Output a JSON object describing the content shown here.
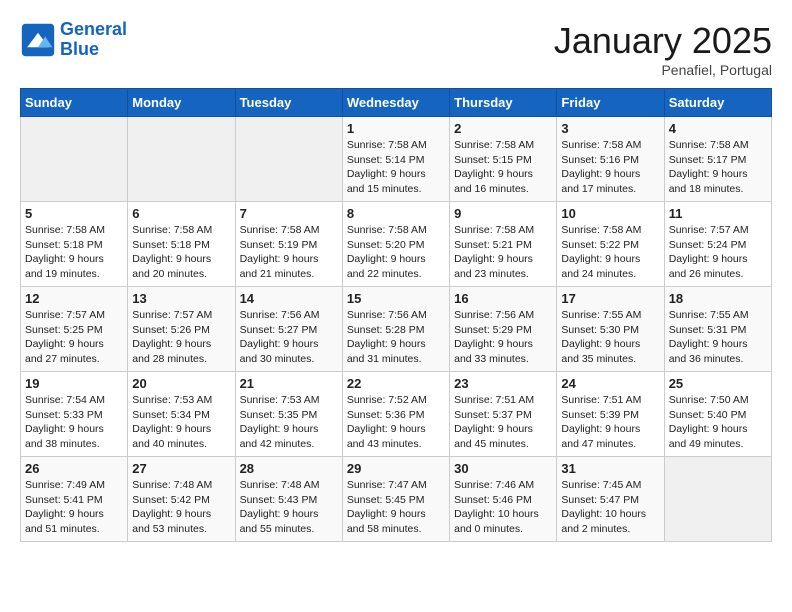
{
  "header": {
    "logo_line1": "General",
    "logo_line2": "Blue",
    "title": "January 2025",
    "subtitle": "Penafiel, Portugal"
  },
  "weekdays": [
    "Sunday",
    "Monday",
    "Tuesday",
    "Wednesday",
    "Thursday",
    "Friday",
    "Saturday"
  ],
  "weeks": [
    [
      {
        "day": "",
        "sunrise": "",
        "sunset": "",
        "daylight": ""
      },
      {
        "day": "",
        "sunrise": "",
        "sunset": "",
        "daylight": ""
      },
      {
        "day": "",
        "sunrise": "",
        "sunset": "",
        "daylight": ""
      },
      {
        "day": "1",
        "sunrise": "Sunrise: 7:58 AM",
        "sunset": "Sunset: 5:14 PM",
        "daylight": "Daylight: 9 hours and 15 minutes."
      },
      {
        "day": "2",
        "sunrise": "Sunrise: 7:58 AM",
        "sunset": "Sunset: 5:15 PM",
        "daylight": "Daylight: 9 hours and 16 minutes."
      },
      {
        "day": "3",
        "sunrise": "Sunrise: 7:58 AM",
        "sunset": "Sunset: 5:16 PM",
        "daylight": "Daylight: 9 hours and 17 minutes."
      },
      {
        "day": "4",
        "sunrise": "Sunrise: 7:58 AM",
        "sunset": "Sunset: 5:17 PM",
        "daylight": "Daylight: 9 hours and 18 minutes."
      }
    ],
    [
      {
        "day": "5",
        "sunrise": "Sunrise: 7:58 AM",
        "sunset": "Sunset: 5:18 PM",
        "daylight": "Daylight: 9 hours and 19 minutes."
      },
      {
        "day": "6",
        "sunrise": "Sunrise: 7:58 AM",
        "sunset": "Sunset: 5:18 PM",
        "daylight": "Daylight: 9 hours and 20 minutes."
      },
      {
        "day": "7",
        "sunrise": "Sunrise: 7:58 AM",
        "sunset": "Sunset: 5:19 PM",
        "daylight": "Daylight: 9 hours and 21 minutes."
      },
      {
        "day": "8",
        "sunrise": "Sunrise: 7:58 AM",
        "sunset": "Sunset: 5:20 PM",
        "daylight": "Daylight: 9 hours and 22 minutes."
      },
      {
        "day": "9",
        "sunrise": "Sunrise: 7:58 AM",
        "sunset": "Sunset: 5:21 PM",
        "daylight": "Daylight: 9 hours and 23 minutes."
      },
      {
        "day": "10",
        "sunrise": "Sunrise: 7:58 AM",
        "sunset": "Sunset: 5:22 PM",
        "daylight": "Daylight: 9 hours and 24 minutes."
      },
      {
        "day": "11",
        "sunrise": "Sunrise: 7:57 AM",
        "sunset": "Sunset: 5:24 PM",
        "daylight": "Daylight: 9 hours and 26 minutes."
      }
    ],
    [
      {
        "day": "12",
        "sunrise": "Sunrise: 7:57 AM",
        "sunset": "Sunset: 5:25 PM",
        "daylight": "Daylight: 9 hours and 27 minutes."
      },
      {
        "day": "13",
        "sunrise": "Sunrise: 7:57 AM",
        "sunset": "Sunset: 5:26 PM",
        "daylight": "Daylight: 9 hours and 28 minutes."
      },
      {
        "day": "14",
        "sunrise": "Sunrise: 7:56 AM",
        "sunset": "Sunset: 5:27 PM",
        "daylight": "Daylight: 9 hours and 30 minutes."
      },
      {
        "day": "15",
        "sunrise": "Sunrise: 7:56 AM",
        "sunset": "Sunset: 5:28 PM",
        "daylight": "Daylight: 9 hours and 31 minutes."
      },
      {
        "day": "16",
        "sunrise": "Sunrise: 7:56 AM",
        "sunset": "Sunset: 5:29 PM",
        "daylight": "Daylight: 9 hours and 33 minutes."
      },
      {
        "day": "17",
        "sunrise": "Sunrise: 7:55 AM",
        "sunset": "Sunset: 5:30 PM",
        "daylight": "Daylight: 9 hours and 35 minutes."
      },
      {
        "day": "18",
        "sunrise": "Sunrise: 7:55 AM",
        "sunset": "Sunset: 5:31 PM",
        "daylight": "Daylight: 9 hours and 36 minutes."
      }
    ],
    [
      {
        "day": "19",
        "sunrise": "Sunrise: 7:54 AM",
        "sunset": "Sunset: 5:33 PM",
        "daylight": "Daylight: 9 hours and 38 minutes."
      },
      {
        "day": "20",
        "sunrise": "Sunrise: 7:53 AM",
        "sunset": "Sunset: 5:34 PM",
        "daylight": "Daylight: 9 hours and 40 minutes."
      },
      {
        "day": "21",
        "sunrise": "Sunrise: 7:53 AM",
        "sunset": "Sunset: 5:35 PM",
        "daylight": "Daylight: 9 hours and 42 minutes."
      },
      {
        "day": "22",
        "sunrise": "Sunrise: 7:52 AM",
        "sunset": "Sunset: 5:36 PM",
        "daylight": "Daylight: 9 hours and 43 minutes."
      },
      {
        "day": "23",
        "sunrise": "Sunrise: 7:51 AM",
        "sunset": "Sunset: 5:37 PM",
        "daylight": "Daylight: 9 hours and 45 minutes."
      },
      {
        "day": "24",
        "sunrise": "Sunrise: 7:51 AM",
        "sunset": "Sunset: 5:39 PM",
        "daylight": "Daylight: 9 hours and 47 minutes."
      },
      {
        "day": "25",
        "sunrise": "Sunrise: 7:50 AM",
        "sunset": "Sunset: 5:40 PM",
        "daylight": "Daylight: 9 hours and 49 minutes."
      }
    ],
    [
      {
        "day": "26",
        "sunrise": "Sunrise: 7:49 AM",
        "sunset": "Sunset: 5:41 PM",
        "daylight": "Daylight: 9 hours and 51 minutes."
      },
      {
        "day": "27",
        "sunrise": "Sunrise: 7:48 AM",
        "sunset": "Sunset: 5:42 PM",
        "daylight": "Daylight: 9 hours and 53 minutes."
      },
      {
        "day": "28",
        "sunrise": "Sunrise: 7:48 AM",
        "sunset": "Sunset: 5:43 PM",
        "daylight": "Daylight: 9 hours and 55 minutes."
      },
      {
        "day": "29",
        "sunrise": "Sunrise: 7:47 AM",
        "sunset": "Sunset: 5:45 PM",
        "daylight": "Daylight: 9 hours and 58 minutes."
      },
      {
        "day": "30",
        "sunrise": "Sunrise: 7:46 AM",
        "sunset": "Sunset: 5:46 PM",
        "daylight": "Daylight: 10 hours and 0 minutes."
      },
      {
        "day": "31",
        "sunrise": "Sunrise: 7:45 AM",
        "sunset": "Sunset: 5:47 PM",
        "daylight": "Daylight: 10 hours and 2 minutes."
      },
      {
        "day": "",
        "sunrise": "",
        "sunset": "",
        "daylight": ""
      }
    ]
  ]
}
